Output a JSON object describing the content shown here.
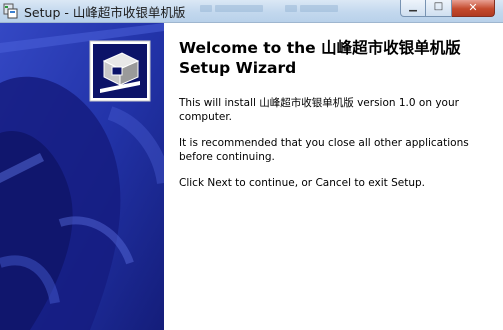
{
  "window": {
    "title": "Setup - 山峰超市收银单机版",
    "buttons": {
      "minimize_icon": "minimize-icon",
      "maximize_icon": "maximize-icon",
      "close_icon": "close-icon"
    }
  },
  "wizard": {
    "heading_line1": "Welcome to the 山峰超市收银单机版",
    "heading_line2": "Setup Wizard",
    "paragraph1": "This will install 山峰超市收银单机版 version 1.0 on your computer.",
    "paragraph2": "It is recommended that you close all other applications before continuing.",
    "paragraph3": "Click Next to continue, or Cancel to exit Setup."
  },
  "colors": {
    "banner_dark": "#1a1f8a",
    "banner_mid": "#2b39b5",
    "banner_light": "#3d52cc",
    "close_button": "#c44a2d",
    "titlebar": "#c3d8ee"
  }
}
